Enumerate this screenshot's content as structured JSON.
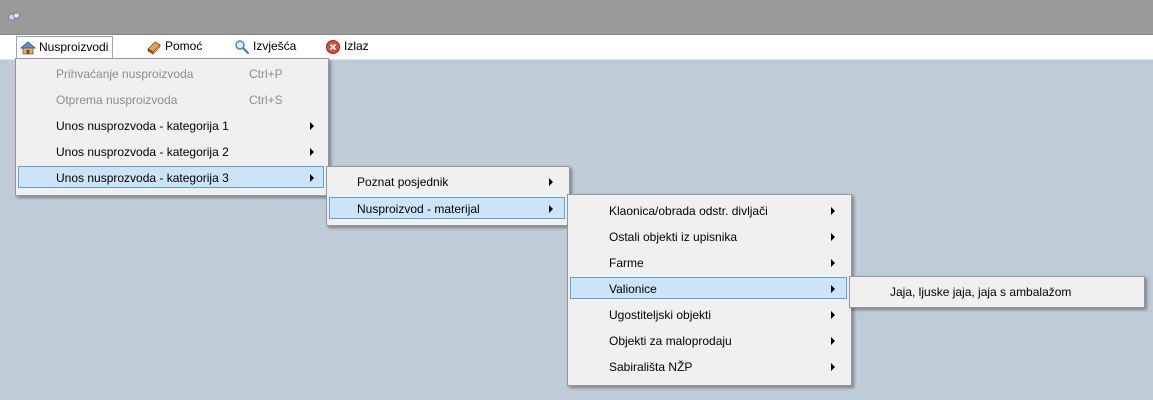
{
  "menubar": {
    "items": [
      {
        "label": "Nusproizvodi",
        "icon": "house-icon"
      },
      {
        "label": "Pomoć",
        "icon": "book-icon"
      },
      {
        "label": "Izvješća",
        "icon": "magnifier-icon"
      },
      {
        "label": "Izlaz",
        "icon": "close-circle-icon"
      }
    ]
  },
  "menu1": {
    "items": [
      {
        "label": "Prihvaćanje nusproizvoda",
        "shortcut": "Ctrl+P"
      },
      {
        "label": "Otprema nusproizvoda",
        "shortcut": "Ctrl+S"
      },
      {
        "label": "Unos nusprozvoda - kategorija 1"
      },
      {
        "label": "Unos nusprozvoda - kategorija 2"
      },
      {
        "label": "Unos nusprozvoda - kategorija 3"
      }
    ]
  },
  "menu2": {
    "items": [
      {
        "label": "Poznat posjednik"
      },
      {
        "label": "Nusproizvod - materijal"
      }
    ]
  },
  "menu3": {
    "items": [
      {
        "label": "Klaonica/obrada odstr. divljači"
      },
      {
        "label": "Ostali objekti iz upisnika"
      },
      {
        "label": "Farme"
      },
      {
        "label": "Valionice"
      },
      {
        "label": "Ugostiteljski objekti"
      },
      {
        "label": "Objekti za maloprodaju"
      },
      {
        "label": "Sabirališta NŽP"
      }
    ]
  },
  "menu4": {
    "items": [
      {
        "label": "Jaja, ljuske jaja, jaja s ambalažom"
      }
    ]
  },
  "colors": {
    "workspace": "#bfcbd7",
    "titlebar": "#9a9a9a",
    "highlight": "#cce4f7",
    "highlight_border": "#5fa1d6",
    "disabled_text": "#8d8d8d"
  }
}
